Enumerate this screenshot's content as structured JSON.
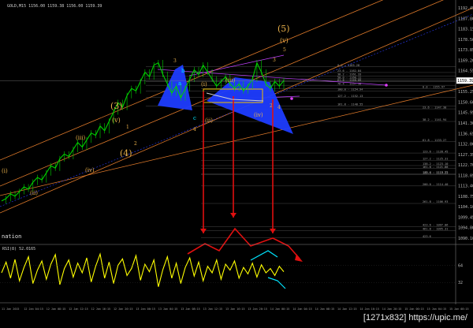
{
  "header": {
    "symbol_line": "GOLD,M15  1156.00  1159.38  1156.00  1159.39"
  },
  "price_axis": {
    "labels": [
      "1192.45",
      "1187.80",
      "1183.15",
      "1178.50",
      "1173.85",
      "1169.20",
      "1164.55",
      "1159.90",
      "1155.25",
      "1150.60",
      "1145.95",
      "1141.30",
      "1136.65",
      "1132.00",
      "1127.35",
      "1122.70",
      "1118.05",
      "1113.40",
      "1108.75",
      "1104.10",
      "1099.45",
      "1094.80",
      "1090.10"
    ],
    "current": "1159.39"
  },
  "rsi": {
    "label": "RSI(8) 52.0165",
    "axis_labels": [
      "64",
      "32"
    ]
  },
  "fib_levels": [
    {
      "label": "0.0 - 1165.28",
      "price": 1165.28
    },
    {
      "label": "23.6 - 1162.84",
      "price": 1162.84
    },
    {
      "label": "38.2 - 1161.33",
      "price": 1161.33
    },
    {
      "label": "50.0 - 1160.11",
      "price": 1160.11
    },
    {
      "label": "61.8 - 1158.89",
      "price": 1158.89
    },
    {
      "label": "76.4 - 1157.38",
      "price": 1157.38
    },
    {
      "label": "100.0 - 1154.94",
      "price": 1154.94
    },
    {
      "label": "127.2 - 1152.13",
      "price": 1152.13
    },
    {
      "label": "161.8 - 1148.55",
      "price": 1148.55
    },
    {
      "label": "0.0 - 1155.97",
      "price": 1155.97
    },
    {
      "label": "23.6 - 1147.30",
      "price": 1147.3
    },
    {
      "label": "38.2 - 1141.94",
      "price": 1141.94
    },
    {
      "label": "61.8 - 1133.27",
      "price": 1133.27
    },
    {
      "label": "100.0 - 1119.23",
      "price": 1119.23
    },
    {
      "label": "123.6 - 1128.45",
      "price": 1128.45
    },
    {
      "label": "127.2 - 1125.31",
      "price": 1125.31
    },
    {
      "label": "138.2 - 1123.10",
      "price": 1123.1
    },
    {
      "label": "161.8 - 1121.88",
      "price": 1121.88
    },
    {
      "label": "176.4 - 1119.55",
      "price": 1119.55
    },
    {
      "label": "200.0 - 1114.40",
      "price": 1114.4
    },
    {
      "label": "261.8 - 1106.93",
      "price": 1106.93
    },
    {
      "label": "423.6 - 1097.06",
      "price": 1097.06
    },
    {
      "label": "461.8 - 1095.31",
      "price": 1095.31
    },
    {
      "label": "423.6",
      "price": 1092.2
    }
  ],
  "wave_labels": [
    "(5)",
    "(v)",
    "(3)",
    "(v)",
    "(4)",
    "(iii)",
    "(iv)",
    "(ii)",
    "(i)",
    "(iii)",
    "(i)",
    "(ii)",
    "(iv)",
    "3",
    "5",
    "3",
    "2",
    "4",
    "1",
    "2",
    "4",
    "b",
    "a",
    "c"
  ],
  "text_left": [
    "nation"
  ],
  "time_axis": [
    "11 Jan 2015",
    "12 Jan 04:15",
    "12 Jan 08:15",
    "12 Jan 12:15",
    "12 Jan 16:15",
    "12 Jan 20:15",
    "13 Jan 00:15",
    "13 Jan 04:15",
    "13 Jan 08:15",
    "13 Jan 12:15",
    "13 Jan 16:15",
    "13 Jan 20:15",
    "14 Jan 00:15",
    "14 Jan 04:15",
    "14 Jan 08:15",
    "14 Jan 12:15",
    "14 Jan 16:15",
    "14 Jan 20:15",
    "15 Jan 00:15",
    "15 Jan 04:15",
    "15 Jan 08:15"
  ],
  "watermark": "[1271x832] https://upic.me/",
  "colors": {
    "background": "#000000",
    "candle": "#00d000",
    "rsi": "#ffff00",
    "wave": "#e8b04a",
    "channel": "#e07a2a",
    "harmonic": "#1e3cff",
    "arrow": "#e01010",
    "cyan": "#00e5ff"
  },
  "chart_data": {
    "type": "line",
    "title": "GOLD,M15",
    "ylim": [
      1090.1,
      1192.45
    ],
    "price_series": [
      1108,
      1109,
      1111,
      1110,
      1112,
      1114,
      1113,
      1116,
      1118,
      1117,
      1120,
      1123,
      1122,
      1126,
      1128,
      1127,
      1130,
      1133,
      1131,
      1134,
      1137,
      1136,
      1140,
      1138,
      1142,
      1146,
      1150,
      1148,
      1153,
      1156,
      1155,
      1159,
      1163,
      1161,
      1166,
      1167,
      1162,
      1158,
      1154,
      1157,
      1152,
      1156,
      1160,
      1164,
      1162,
      1166,
      1163,
      1160,
      1157,
      1159,
      1161,
      1158,
      1156,
      1158,
      1155,
      1157,
      1160,
      1167,
      1163,
      1158,
      1156,
      1159,
      1157,
      1159.39
    ],
    "rsi_series": [
      50,
      70,
      40,
      75,
      35,
      60,
      80,
      30,
      55,
      72,
      38,
      66,
      84,
      28,
      58,
      74,
      42,
      68,
      50,
      78,
      33,
      62,
      85,
      40,
      70,
      30,
      64,
      76,
      45,
      58,
      82,
      36,
      66,
      52,
      74,
      24,
      56,
      80,
      40,
      68,
      30,
      60,
      78,
      44,
      70,
      35,
      62,
      50,
      74,
      38,
      66,
      55,
      72,
      40,
      60,
      48,
      68,
      42,
      65,
      50,
      58,
      45,
      62,
      52
    ]
  }
}
